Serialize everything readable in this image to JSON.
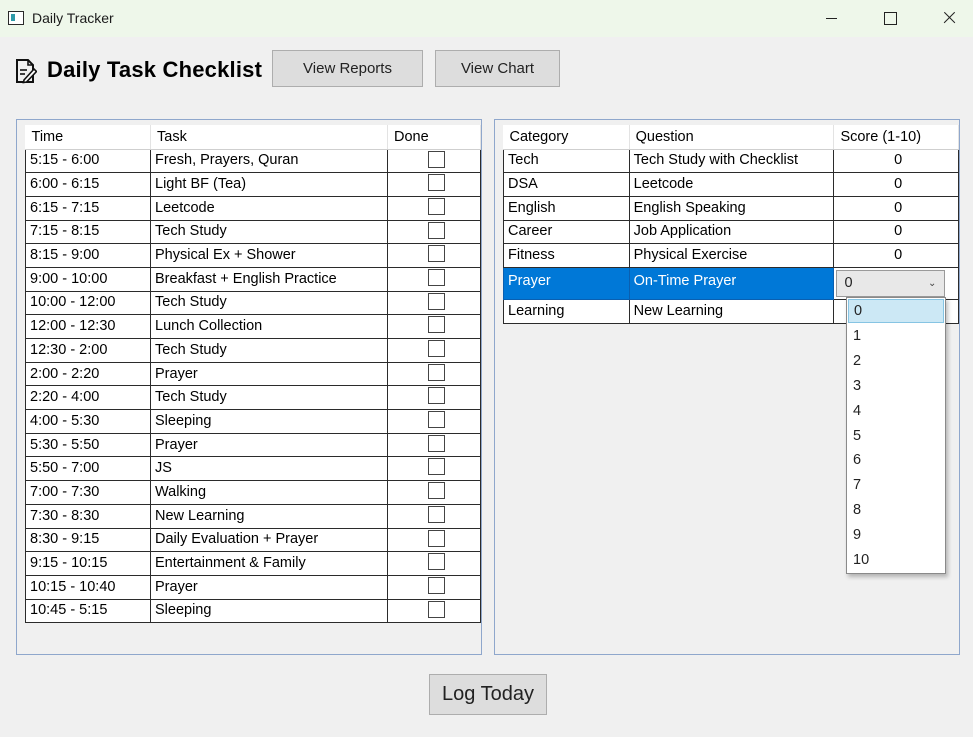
{
  "window": {
    "title": "Daily Tracker"
  },
  "header": {
    "title": "Daily Task Checklist",
    "icon": "edit-document-icon",
    "view_reports_label": "View Reports",
    "view_chart_label": "View Chart"
  },
  "schedule": {
    "columns": [
      "Time",
      "Task",
      "Done"
    ],
    "rows": [
      {
        "time": "5:15 - 6:00",
        "task": "Fresh, Prayers, Quran",
        "done": false
      },
      {
        "time": "6:00 - 6:15",
        "task": "Light BF (Tea)",
        "done": false
      },
      {
        "time": "6:15 - 7:15",
        "task": "Leetcode",
        "done": false
      },
      {
        "time": "7:15 - 8:15",
        "task": "Tech Study",
        "done": false
      },
      {
        "time": "8:15 - 9:00",
        "task": "Physical Ex + Shower",
        "done": false
      },
      {
        "time": "9:00 - 10:00",
        "task": "Breakfast + English Practice",
        "done": false
      },
      {
        "time": "10:00 - 12:00",
        "task": "Tech Study",
        "done": false
      },
      {
        "time": "12:00 - 12:30",
        "task": "Lunch Collection",
        "done": false
      },
      {
        "time": "12:30 - 2:00",
        "task": "Tech Study",
        "done": false
      },
      {
        "time": "2:00 - 2:20",
        "task": "Prayer",
        "done": false
      },
      {
        "time": "2:20 - 4:00",
        "task": "Tech Study",
        "done": false
      },
      {
        "time": "4:00 - 5:30",
        "task": "Sleeping",
        "done": false
      },
      {
        "time": "5:30 - 5:50",
        "task": "Prayer",
        "done": false
      },
      {
        "time": "5:50 - 7:00",
        "task": "JS",
        "done": false
      },
      {
        "time": "7:00 - 7:30",
        "task": "Walking",
        "done": false
      },
      {
        "time": "7:30 - 8:30",
        "task": "New Learning",
        "done": false
      },
      {
        "time": "8:30 - 9:15",
        "task": "Daily Evaluation + Prayer",
        "done": false
      },
      {
        "time": "9:15 - 10:15",
        "task": "Entertainment & Family",
        "done": false
      },
      {
        "time": "10:15 - 10:40",
        "task": "Prayer",
        "done": false
      },
      {
        "time": "10:45 - 5:15",
        "task": "Sleeping",
        "done": false
      }
    ]
  },
  "scores": {
    "columns": [
      "Category",
      "Question",
      "Score (1-10)"
    ],
    "rows": [
      {
        "category": "Tech",
        "question": "Tech Study with Checklist",
        "score": "0"
      },
      {
        "category": "DSA",
        "question": "Leetcode",
        "score": "0"
      },
      {
        "category": "English",
        "question": "English Speaking",
        "score": "0"
      },
      {
        "category": "Career",
        "question": "Job Application",
        "score": "0"
      },
      {
        "category": "Fitness",
        "question": "Physical Exercise",
        "score": "0"
      },
      {
        "category": "Prayer",
        "question": "On-Time Prayer",
        "score": "0",
        "selected": true
      },
      {
        "category": "Learning",
        "question": "New Learning",
        "score": ""
      }
    ],
    "dropdown_options": [
      "0",
      "1",
      "2",
      "3",
      "4",
      "5",
      "6",
      "7",
      "8",
      "9",
      "10"
    ],
    "dropdown_highlighted": "0"
  },
  "footer": {
    "log_today_label": "Log Today"
  },
  "colors": {
    "titlebar_bg": "#eef7ea",
    "selection": "#0078d7",
    "panel_border": "#8fa7cc",
    "dropdown_highlight": "#cce8f5"
  }
}
